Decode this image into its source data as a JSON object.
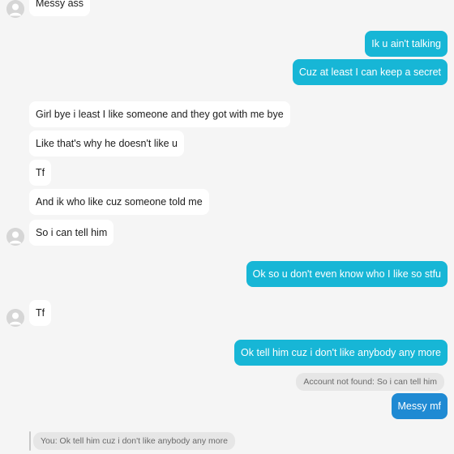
{
  "messages": {
    "m1": "Messy ass",
    "m2": "Ik u ain't talking",
    "m3": "Cuz at least I can keep a secret",
    "m4": "Girl bye i least I like someone and they got with me bye",
    "m5": "Like that's why he doesn't like u",
    "m6": "Tf",
    "m7": "And ik who like cuz someone told me",
    "m8": "So i can tell him",
    "m9": "Ok so u don't even know who I like so stfu",
    "m10": "Tf",
    "m11": "Ok tell him cuz i don't like anybody any more",
    "m12": "Messy mf"
  },
  "quotes": {
    "account_not_found": "Account not found: So i can tell him",
    "you_reply": "You: Ok tell him cuz i don't like anybody any more"
  },
  "icons": {
    "avatar": "default-avatar-icon"
  },
  "colors": {
    "incoming_bubble": "#ffffff",
    "outgoing_bubble": "#17b6d6",
    "outgoing_last": "#1f8ad3",
    "background": "#f5f5f5"
  }
}
